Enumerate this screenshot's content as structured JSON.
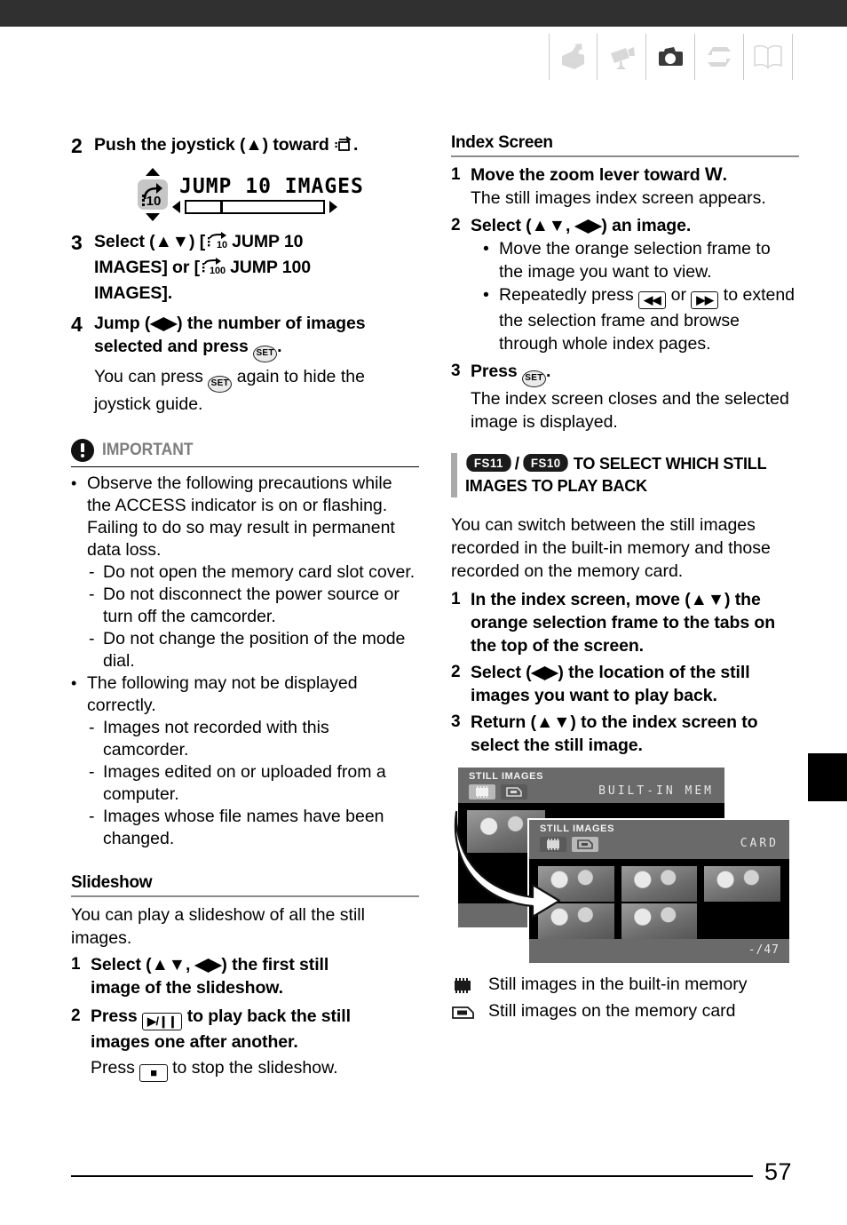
{
  "header": {
    "icons": [
      {
        "name": "introduction-box-icon",
        "state": "inactive"
      },
      {
        "name": "camcorder-icon",
        "state": "inactive"
      },
      {
        "name": "photo-camera-icon",
        "state": "active"
      },
      {
        "name": "external-connections-icon",
        "state": "inactive"
      },
      {
        "name": "additional-information-book-icon",
        "state": "inactive"
      }
    ],
    "active_color": "#3a3a3a",
    "inactive_color": "#d8d8d8"
  },
  "left_column": {
    "step2": {
      "num": "2",
      "text_before": "Push the joystick (",
      "arrow": "▲",
      "text_after": ") toward",
      "end": "."
    },
    "joystick_guide": {
      "label": "JUMP 10 IMAGES",
      "icon_number": "10"
    },
    "step3": {
      "num": "3",
      "line1_a": "Select (",
      "line1_arrows": "▲▼",
      "line1_b": ") [",
      "jump10_num": "10",
      "line1_c": "JUMP 10",
      "line2_a": "IMAGES] or [",
      "jump100_num": "100",
      "line2_b": "JUMP 100",
      "line3": "IMAGES]."
    },
    "step4": {
      "num": "4",
      "line1_a": "Jump (",
      "arrows": "◀▶",
      "line1_b": ") the number of images",
      "line2_a": "selected and press",
      "set_label": "SET",
      "line2_b": ".",
      "sub_a": "You can press",
      "sub_set": "SET",
      "sub_b": "again to hide the",
      "sub_c": "joystick guide."
    },
    "important": {
      "label": "IMPORTANT",
      "items": [
        {
          "text": "Observe the following precautions while the ACCESS indicator is on or flashing. Failing to do so may result in permanent data loss.",
          "sub": [
            "Do not open the memory card slot cover.",
            "Do not disconnect the power source or turn off the camcorder.",
            "Do not change the position of the mode dial."
          ]
        },
        {
          "text": "The following may not be displayed correctly.",
          "sub": [
            "Images not recorded with this camcorder.",
            "Images edited on or uploaded from a computer.",
            "Images whose file names have been changed."
          ]
        }
      ]
    },
    "slideshow": {
      "heading": "Slideshow",
      "intro": "You can play a slideshow of all the still images.",
      "step1": {
        "num": "1",
        "a": "Select (",
        "arrows1": "▲▼",
        "comma": ", ",
        "arrows2": "◀▶",
        "b": ") the first still",
        "line2": "image of the slideshow."
      },
      "step2": {
        "num": "2",
        "a": "Press",
        "btn": "▶/❙❙",
        "b": "to play back the still",
        "line2": "images one after another.",
        "sub_a": "Press",
        "sub_btn": "■",
        "sub_b": "to stop the slideshow."
      }
    }
  },
  "right_column": {
    "index_screen": {
      "heading": "Index Screen",
      "step1": {
        "num": "1",
        "head_a": "Move the zoom lever toward ",
        "head_w": "W",
        "head_b": ".",
        "sub": "The still images index screen appears."
      },
      "step2": {
        "num": "2",
        "head_a": "Select (",
        "arrows1": "▲▼",
        "comma": ", ",
        "arrows2": "◀▶",
        "head_b": ") an image.",
        "bullets": [
          {
            "text": "Move the orange selection frame to the image you want to view."
          },
          {
            "text_a": "Repeatedly press",
            "btn1": "◀◀",
            "mid": "or",
            "btn2": "▶▶",
            "text_b": "to extend the selection frame and browse through whole index pages."
          }
        ]
      },
      "step3": {
        "num": "3",
        "head_a": "Press",
        "set_label": "SET",
        "head_b": ".",
        "sub": "The index screen closes and the selected image is displayed."
      }
    },
    "fs_section": {
      "badge1": "FS11",
      "separator": "/",
      "badge2": "FS10",
      "title_line1": "To select which still",
      "title_line2": "images to play back"
    },
    "body_intro": "You can switch between the still images recorded in the built-in memory and those recorded on the memory card.",
    "steps": [
      {
        "num": "1",
        "a": "In the index screen, move (",
        "arrows": "▲▼",
        "b": ") the",
        "rest": "orange selection frame to the tabs on the top of the screen."
      },
      {
        "num": "2",
        "a": "Select (",
        "arrows": "◀▶",
        "b": ") the location of the still",
        "rest": "images you want to play back."
      },
      {
        "num": "3",
        "a": "Return (",
        "arrows": "▲▼",
        "b": ") to the index screen to",
        "rest": "select the still image."
      }
    ],
    "illustration": {
      "screen_a": {
        "title": "STILL IMAGES",
        "location": "BUILT-IN MEM",
        "active_tab": "built-in-memory"
      },
      "screen_b": {
        "title": "STILL IMAGES",
        "location": "CARD",
        "active_tab": "memory-card",
        "counter": "-/47"
      }
    },
    "legend": [
      {
        "icon": "built-in-memory-icon",
        "text": "Still images in the built-in memory"
      },
      {
        "icon": "memory-card-icon",
        "text": "Still images on the memory card"
      }
    ]
  },
  "footer": {
    "page_number": "57"
  }
}
